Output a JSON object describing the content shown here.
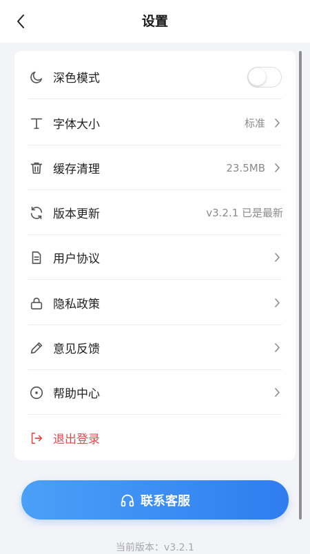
{
  "header": {
    "title": "设置"
  },
  "settings": {
    "dark_mode": {
      "label": "深色模式",
      "enabled": false
    },
    "font_size": {
      "label": "字体大小",
      "value": "标准"
    },
    "cache": {
      "label": "缓存清理",
      "value": "23.5MB"
    },
    "update": {
      "label": "版本更新",
      "value": "v3.2.1 已是最新"
    },
    "agreement": {
      "label": "用户协议"
    },
    "privacy": {
      "label": "隐私政策"
    },
    "feedback": {
      "label": "意见反馈"
    },
    "help": {
      "label": "帮助中心"
    },
    "logout": {
      "label": "退出登录"
    }
  },
  "contact_button": {
    "label": "联系客服"
  },
  "footer": {
    "version_text": "当前版本：v3.2.1"
  },
  "colors": {
    "accent": "#3b8cf3",
    "danger": "#e5484d",
    "icon": "#555555",
    "secondary_text": "#8a8a8a"
  }
}
